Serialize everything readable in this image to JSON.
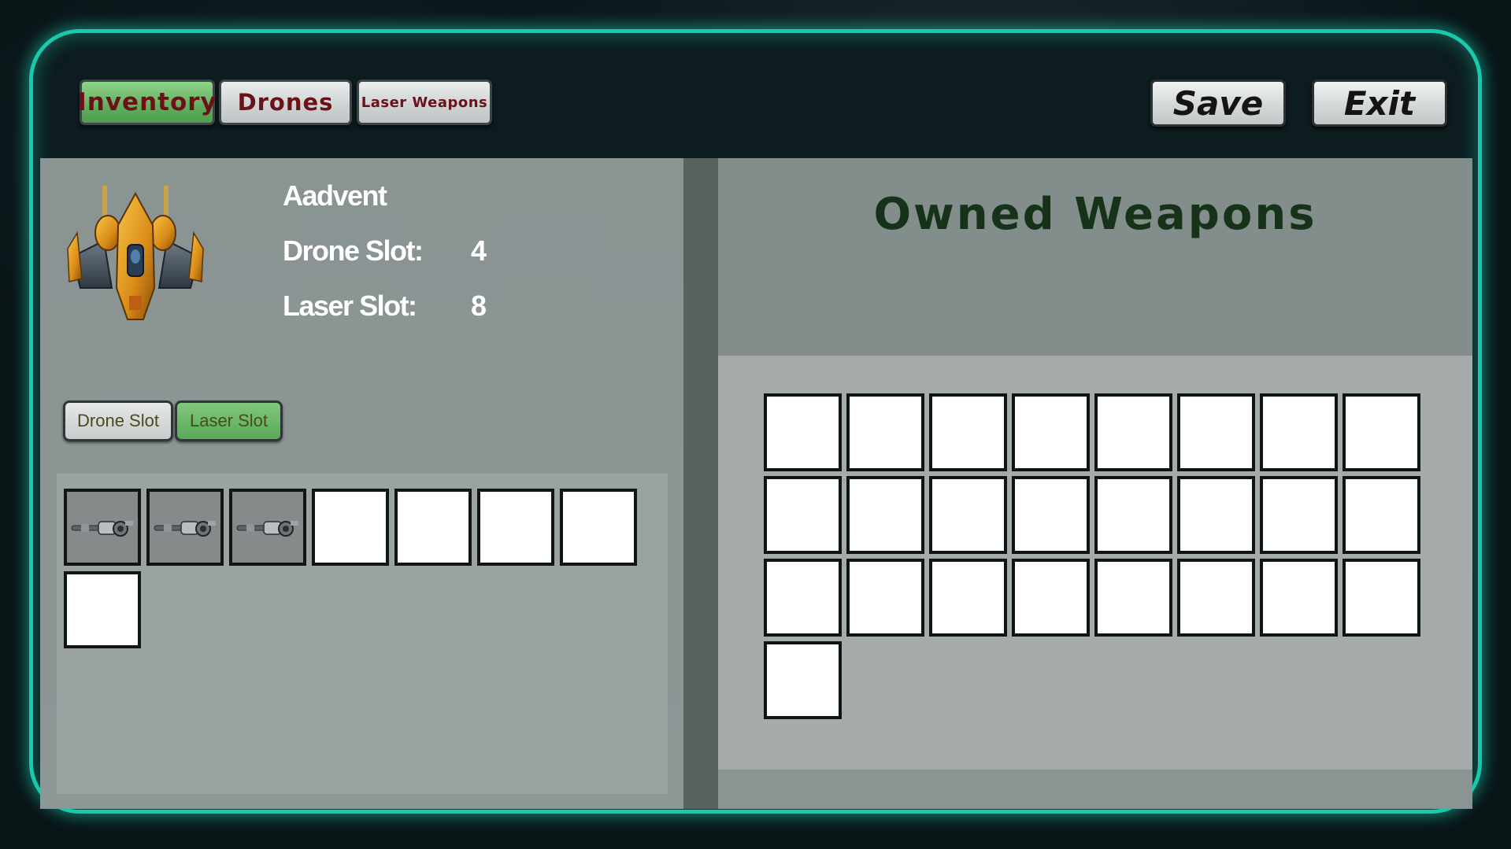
{
  "tabs": {
    "inventory": "Inventory",
    "drones": "Drones",
    "laser_weapons": "Laser Weapons",
    "active": "inventory"
  },
  "toolbar": {
    "save_label": "Save",
    "exit_label": "Exit"
  },
  "ship": {
    "name": "Aadvent",
    "drone_slot_label": "Drone Slot:",
    "drone_slot_value": "4",
    "laser_slot_label": "Laser Slot:",
    "laser_slot_value": "8"
  },
  "slot_tabs": {
    "drone_slot": "Drone Slot",
    "laser_slot": "Laser Slot",
    "active": "laser_slot"
  },
  "equipped_laser_slots": {
    "total": 8,
    "filled": 3,
    "item_icon": "laser-cannon-icon"
  },
  "owned_weapons": {
    "title": "Owned Weapons",
    "slot_count": 25
  },
  "colors": {
    "frame_glow": "#19c9ad",
    "active_tab": "#62ae5f",
    "tab_text": "#6b1218",
    "title_text": "#16331a"
  }
}
